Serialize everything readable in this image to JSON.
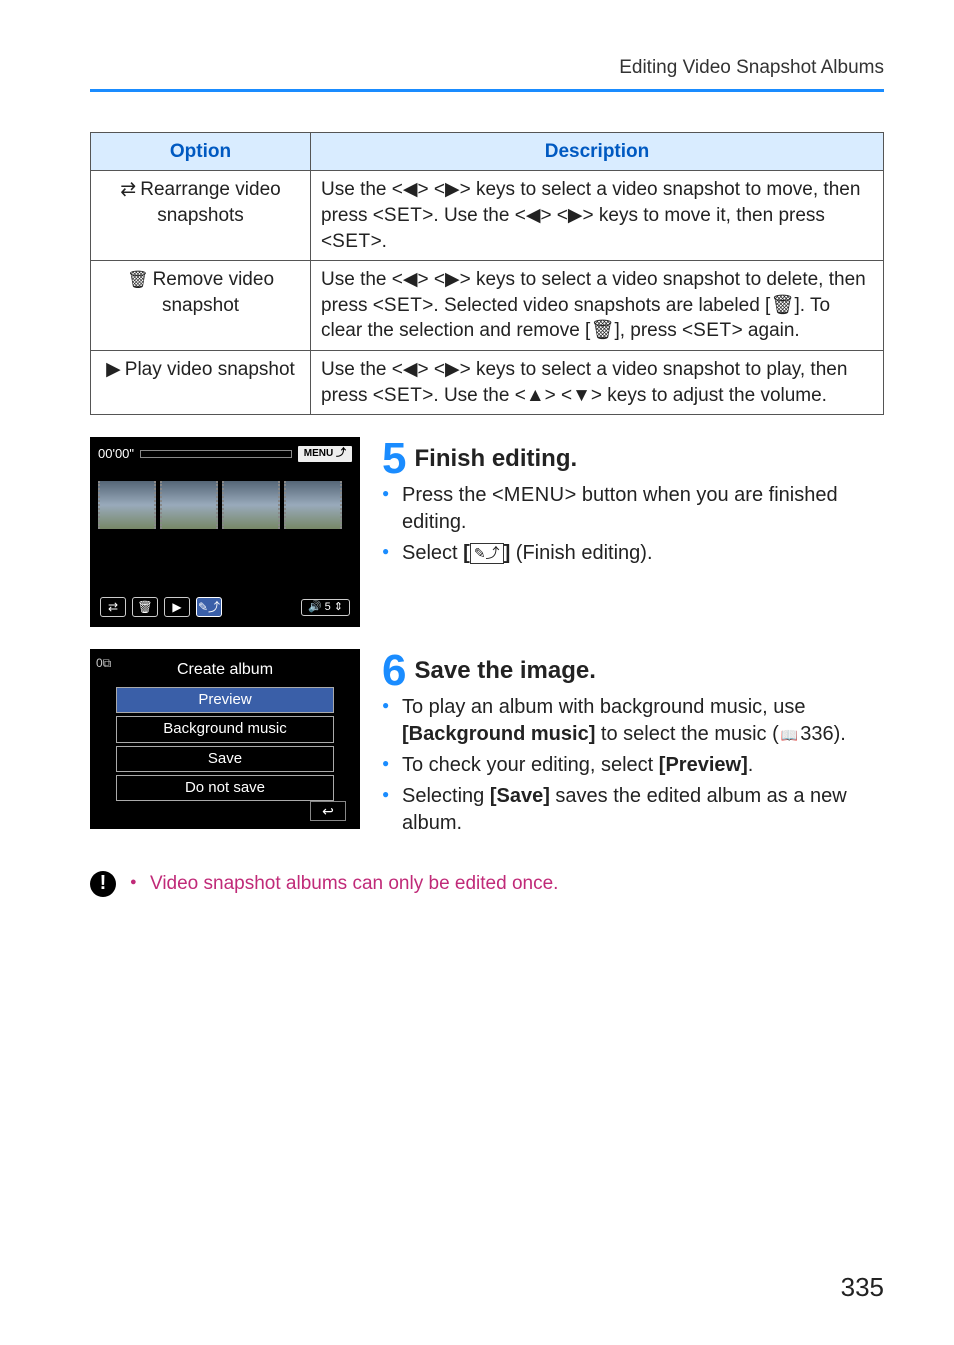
{
  "header": {
    "section_title": "Editing Video Snapshot Albums"
  },
  "table": {
    "head_option": "Option",
    "head_description": "Description",
    "rows": [
      {
        "option_label": "Rearrange video snapshots",
        "desc_prefix": "Use the <",
        "desc_tri1": "◀",
        "desc_mid1": "> <",
        "desc_tri2": "▶",
        "desc_mid2": "> keys to select a video snapshot to move, then press <",
        "desc_set1": "SET",
        "desc_mid3": ">. Use the <",
        "desc_tri3": "◀",
        "desc_mid4": "> <",
        "desc_tri4": "▶",
        "desc_mid5": "> keys to move it, then press <",
        "desc_set2": "SET",
        "desc_suffix": ">."
      },
      {
        "option_label": "Remove video snapshot",
        "desc_prefix": "Use the <",
        "desc_tri1": "◀",
        "desc_mid1": "> <",
        "desc_tri2": "▶",
        "desc_mid2": "> keys to select a video snapshot to delete, then press <",
        "desc_set1": "SET",
        "desc_mid3": ">. Selected video snapshots are labeled [",
        "desc_icon1": "🗑",
        "desc_mid4": "]. To clear the selection and remove [",
        "desc_icon2": "🗑",
        "desc_mid5": "], press <",
        "desc_set2": "SET",
        "desc_suffix": "> again."
      },
      {
        "option_label": "Play video snapshot",
        "desc_prefix": "Use the <",
        "desc_tri1": "◀",
        "desc_mid1": "> <",
        "desc_tri2": "▶",
        "desc_mid2": "> keys to select a video snapshot to play, then press <",
        "desc_set1": "SET",
        "desc_mid3": ">. Use the <",
        "desc_tri3": "▲",
        "desc_mid4": "> <",
        "desc_tri4": "▼",
        "desc_mid5": "> keys to adjust the volume.",
        "desc_set2": "",
        "desc_suffix": ""
      }
    ]
  },
  "step5": {
    "num": "5",
    "title": "Finish editing.",
    "b1_pre": "Press the <",
    "b1_key": "MENU",
    "b1_post": "> button when you are finished editing.",
    "b2_pre": "Select ",
    "b2_icon_open": "[",
    "b2_icon_glyph": "✎⤴",
    "b2_icon_close": "]",
    "b2_post": " (Finish editing).",
    "screen": {
      "timecode": "00'00\"",
      "menu_label": "MENU",
      "volume": "5"
    }
  },
  "step6": {
    "num": "6",
    "title": "Save the image.",
    "b1_pre": "To play an album with background music, use ",
    "b1_bold": "[Background music]",
    "b1_mid": " to select the music (",
    "b1_page": "336",
    "b1_post": ").",
    "b2_pre": "To check your editing, select ",
    "b2_bold": "[Preview]",
    "b2_post": ".",
    "b3_pre": "Selecting ",
    "b3_bold": "[Save]",
    "b3_post": " saves the edited album as a new album.",
    "screen": {
      "title": "Create album",
      "items": [
        "Preview",
        "Background music",
        "Save",
        "Do not save"
      ]
    }
  },
  "note": {
    "text": "Video snapshot albums can only be edited once."
  },
  "pagenum": "335"
}
